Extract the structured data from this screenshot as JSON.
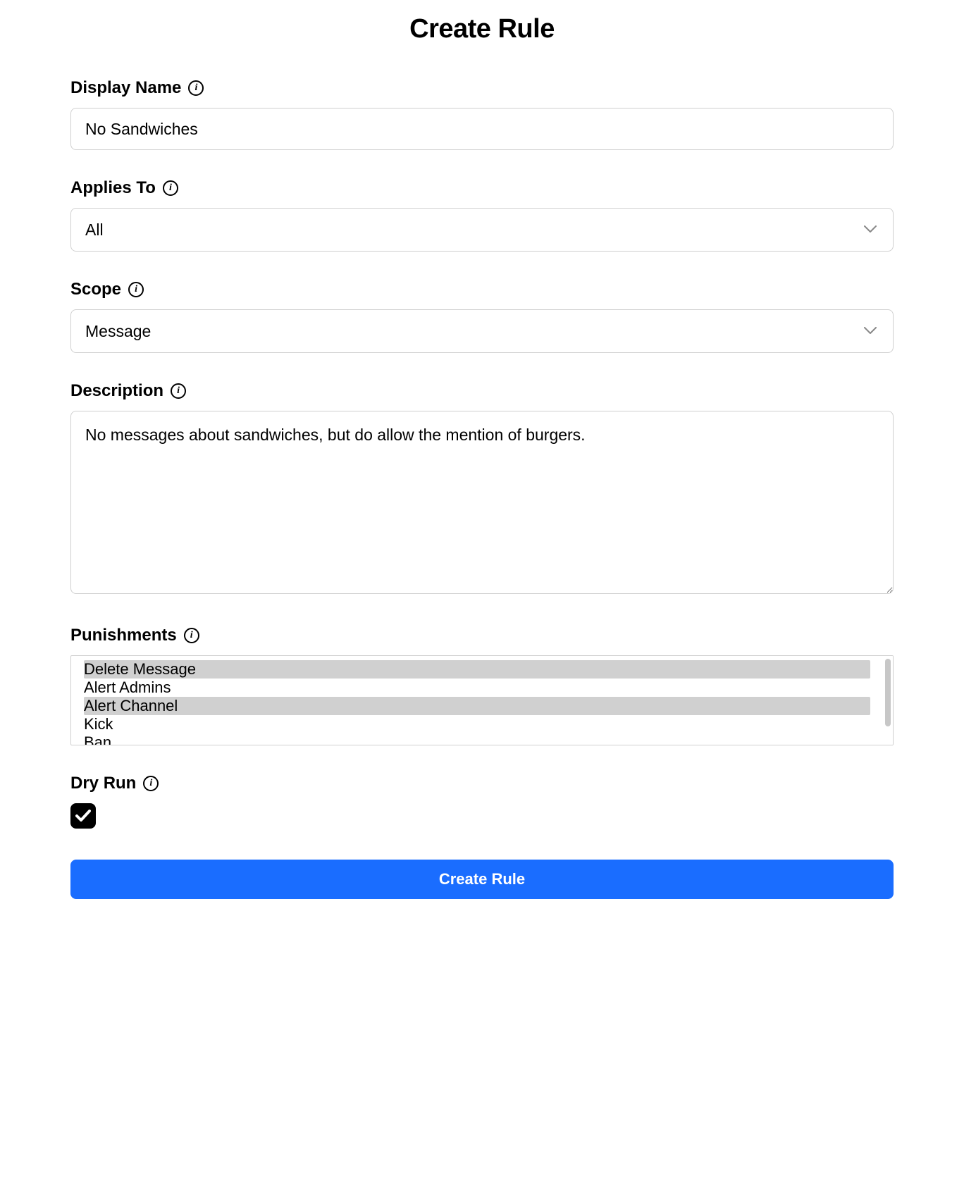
{
  "title": "Create Rule",
  "fields": {
    "displayName": {
      "label": "Display Name",
      "value": "No Sandwiches"
    },
    "appliesTo": {
      "label": "Applies To",
      "value": "All"
    },
    "scope": {
      "label": "Scope",
      "value": "Message"
    },
    "description": {
      "label": "Description",
      "value": "No messages about sandwiches, but do allow the mention of burgers."
    },
    "punishments": {
      "label": "Punishments",
      "options": [
        {
          "label": "Delete Message",
          "selected": true
        },
        {
          "label": "Alert Admins",
          "selected": false
        },
        {
          "label": "Alert Channel",
          "selected": true
        },
        {
          "label": "Kick",
          "selected": false
        },
        {
          "label": "Ban",
          "selected": false
        }
      ]
    },
    "dryRun": {
      "label": "Dry Run",
      "checked": true
    }
  },
  "submitLabel": "Create Rule"
}
